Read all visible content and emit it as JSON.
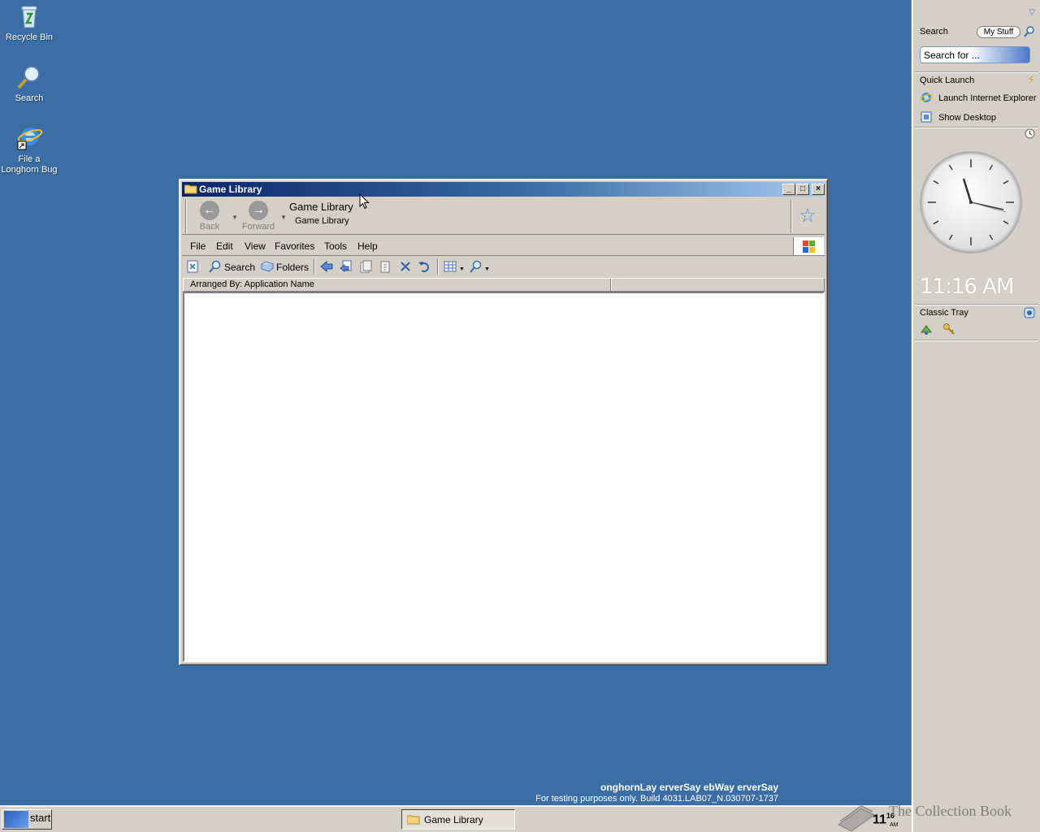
{
  "desktop": {
    "icons": [
      {
        "label": "Recycle Bin",
        "icon": "recycle-bin-icon"
      },
      {
        "label": "Search",
        "icon": "search-magnifier-icon"
      },
      {
        "label": "File a Longhorn Bug",
        "icon": "internet-explorer-shortcut-icon"
      }
    ],
    "watermark": {
      "line1": "onghornLay erverSay ebWay erverSay",
      "line2": "For testing purposes only. Build 4031.LAB07_N.030707-1737"
    }
  },
  "window": {
    "title": "Game Library",
    "nav": {
      "back_label": "Back",
      "forward_label": "Forward",
      "breadcrumb_main": "Game Library",
      "breadcrumb_sub": "Game Library"
    },
    "menu": [
      "File",
      "Edit",
      "View",
      "Favorites",
      "Tools",
      "Help"
    ],
    "toolbar": {
      "search_label": "Search",
      "folders_label": "Folders"
    },
    "column_header": "Arranged By: Application Name"
  },
  "sidebar": {
    "search_title": "Search",
    "mystuff_label": "My Stuff",
    "search_placeholder": "Search for ...",
    "quick_launch_title": "Quick Launch",
    "quick_launch_items": [
      "Launch Internet Explorer",
      "Show Desktop"
    ],
    "clock_time": "11:16 AM",
    "classic_tray_title": "Classic Tray"
  },
  "taskbar": {
    "start_label": "start",
    "task_label": "Game Library",
    "tray_hour": "11",
    "tray_min": "16",
    "tray_ampm": "AM"
  },
  "overlay": {
    "collection_text": "The Collection Book"
  },
  "colors": {
    "desktop": "#3a6ea5",
    "titlebar_start": "#0a246a",
    "titlebar_end": "#a6caf0",
    "chrome": "#d4d0c8"
  }
}
